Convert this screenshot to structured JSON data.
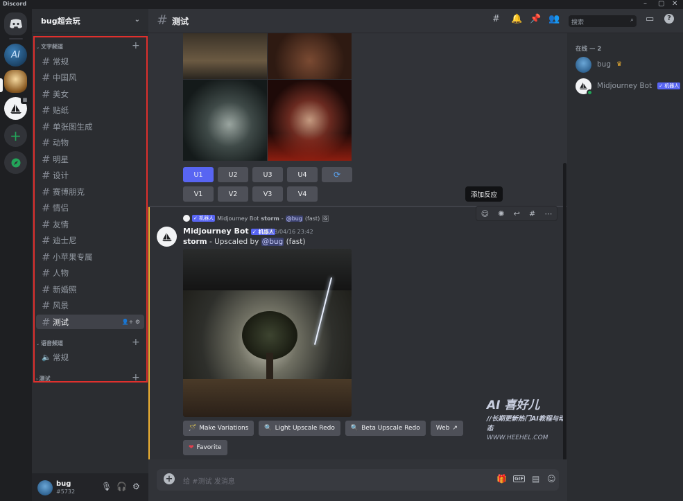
{
  "app": {
    "name": "Discord",
    "window_controls": [
      "–",
      "▢",
      "✕"
    ]
  },
  "server": {
    "name": "bug超会玩"
  },
  "sidebar": {
    "text_category": "文字频道",
    "voice_category": "语音频道",
    "third_category": "测试",
    "text_channels": [
      "常规",
      "中国风",
      "美女",
      "贴纸",
      "单张图生成",
      "动物",
      "明星",
      "设计",
      "赛博朋克",
      "情侣",
      "友情",
      "迪士尼",
      "小苹果专属",
      "人物",
      "新婚照",
      "风景",
      "测试"
    ],
    "active_channel": "测试",
    "voice_channels": [
      "常规"
    ]
  },
  "user": {
    "name": "bug",
    "tag": "#5732"
  },
  "channel": {
    "name": "测试"
  },
  "search": {
    "placeholder": "搜索"
  },
  "grid_buttons": {
    "upscale": [
      "U1",
      "U2",
      "U3",
      "U4"
    ],
    "variation": [
      "V1",
      "V2",
      "V3",
      "V4"
    ],
    "refresh_icon": "refresh-icon"
  },
  "tooltip": "添加反应",
  "message": {
    "reply_tag": "✓ 机器人",
    "reply_author": "Midjourney Bot",
    "reply_text": "storm",
    "reply_mention": "@bug",
    "reply_suffix": "(fast)",
    "author": "Midjourney Bot",
    "author_tag": "✓ 机器人",
    "timestamp": "2023/04/16 23:42",
    "prompt": "storm",
    "body_prefix": "- Upscaled by",
    "mention": "@bug",
    "body_suffix": "(fast)"
  },
  "actions": {
    "make_variations": "Make Variations",
    "light_upscale_redo": "Light Upscale Redo",
    "beta_upscale_redo": "Beta Upscale Redo",
    "web": "Web",
    "favorite": "Favorite"
  },
  "composer": {
    "placeholder": "给 #测试 发消息"
  },
  "members": {
    "header": "在线 — 2",
    "list": [
      {
        "name": "bug"
      },
      {
        "name": "Midjourney Bot",
        "tag": "✓ 机器人"
      }
    ]
  },
  "watermark": {
    "logo": "AI 喜好儿",
    "line1": "//长期更新热门AI教程与动态",
    "line2": "WWW.HEEHEL.COM"
  },
  "colors": {
    "blurple": "#5865f2",
    "online": "#23a559",
    "highlight_bar": "#f0b232",
    "annotation_box": "#e0302d"
  }
}
